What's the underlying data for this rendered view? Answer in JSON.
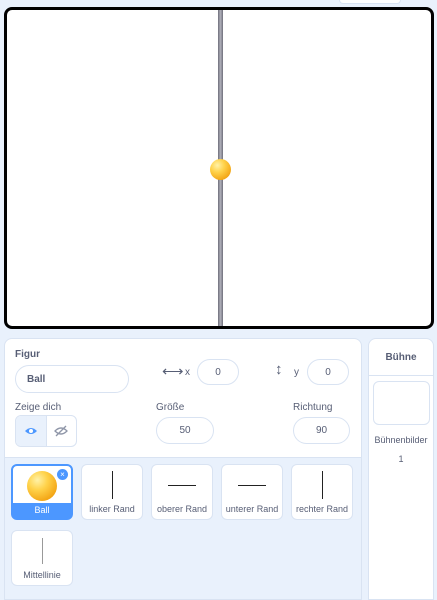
{
  "sprite_info": {
    "heading": "Figur",
    "name": "Ball",
    "x_label": "x",
    "x_value": "0",
    "y_label": "y",
    "y_value": "0",
    "show_label": "Zeige dich",
    "size_label": "Größe",
    "size_value": "50",
    "direction_label": "Richtung",
    "direction_value": "90"
  },
  "sprites": [
    {
      "name": "Ball",
      "selected": true
    },
    {
      "name": "linker Rand"
    },
    {
      "name": "oberer Rand"
    },
    {
      "name": "unterer Rand"
    },
    {
      "name": "rechter Rand"
    },
    {
      "name": "Mittellinie"
    }
  ],
  "stage_panel": {
    "title": "Bühne",
    "backdrops_label": "Bühnenbilder",
    "backdrops_count": "1"
  },
  "icons": {
    "delete": "×"
  },
  "colors": {
    "accent": "#4c97ff",
    "text": "#575e75",
    "background": "#e9f1fc"
  }
}
